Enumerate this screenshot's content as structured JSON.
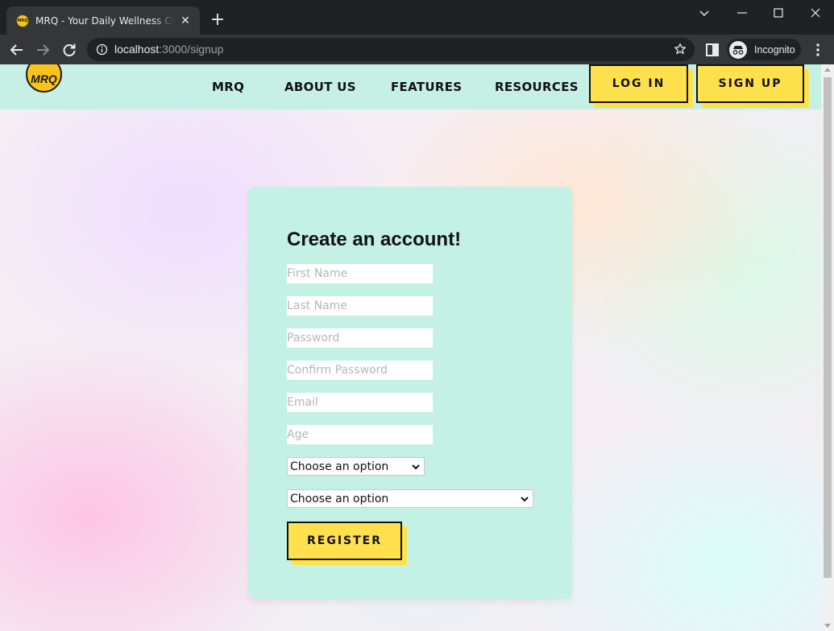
{
  "browser": {
    "tab_title": "MRQ - Your Daily Wellness Companion",
    "favicon_text": "MRQ",
    "url_host": "localhost",
    "url_path": ":3000/signup",
    "incognito_label": "Incognito"
  },
  "nav": {
    "logo_text": "MRQ",
    "links": [
      "MRQ",
      "ABOUT US",
      "FEATURES",
      "RESOURCES"
    ],
    "login_label": "LOG IN",
    "signup_label": "SIGN UP"
  },
  "form": {
    "title": "Create an account!",
    "first_name_placeholder": "First Name",
    "last_name_placeholder": "Last Name",
    "password_placeholder": "Password",
    "confirm_password_placeholder": "Confirm Password",
    "email_placeholder": "Email",
    "age_placeholder": "Age",
    "select1_value": "Choose an option",
    "select2_value": "Choose an option",
    "register_label": "REGISTER"
  },
  "colors": {
    "accent_yellow": "#ffe14d",
    "mint": "#c6f0e6",
    "chrome_dark": "#202124"
  }
}
